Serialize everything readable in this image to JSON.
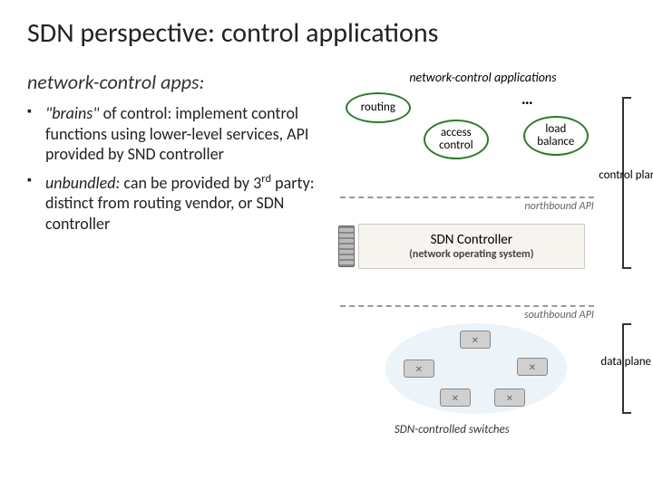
{
  "title": "SDN perspective: control applications",
  "subtitle": "network-control apps:",
  "bullets": [
    {
      "lead": "\"brains\"",
      "rest": " of control: implement control functions using lower-level services, API provided by SND controller"
    },
    {
      "lead": "unbundled:",
      "rest_a": " can be provided by 3",
      "sup": "rd",
      "rest_b": " party: distinct from routing vendor, or SDN controller"
    }
  ],
  "diagram": {
    "apps_label": "network-control applications",
    "routing": "routing",
    "access": "access control",
    "load": "load balance",
    "dots": "…",
    "northbound": "northbound API",
    "controller_title": "SDN Controller",
    "controller_sub": "(network operating system)",
    "southbound": "southbound API",
    "switches_label": "SDN-controlled switches",
    "control_plane": "control plane",
    "data_plane": "data plane"
  }
}
